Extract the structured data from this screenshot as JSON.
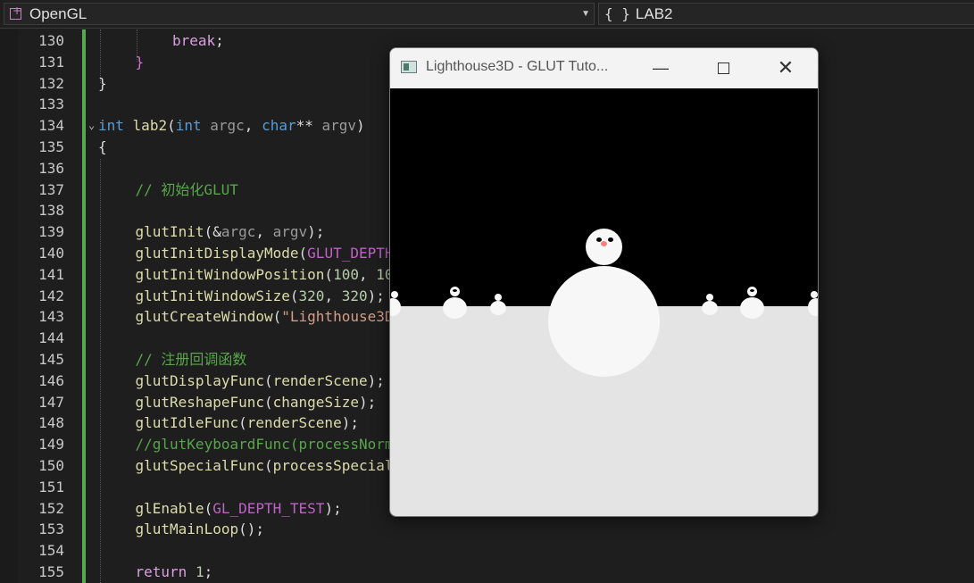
{
  "navbar": {
    "project": "OpenGL",
    "scope_icon": "{ }",
    "scope": "LAB2"
  },
  "editor": {
    "lines": [
      {
        "n": "130",
        "html": "<span class=\"ctl\">break</span>;"
      },
      {
        "n": "131",
        "html": "<span class=\"par\">}</span>"
      },
      {
        "n": "132",
        "html": "}"
      },
      {
        "n": "133",
        "html": ""
      },
      {
        "n": "134",
        "html": "<span class=\"kw\">int</span> <span class=\"fn\">lab2</span>(<span class=\"kw\">int</span> <span class=\"pm\">argc</span>, <span class=\"kw\">char</span>** <span class=\"pm\">argv</span>)"
      },
      {
        "n": "135",
        "html": "{"
      },
      {
        "n": "136",
        "html": ""
      },
      {
        "n": "137",
        "html": "<span class=\"cm\">// 初始化GLUT</span>"
      },
      {
        "n": "138",
        "html": ""
      },
      {
        "n": "139",
        "html": "<span class=\"fn\">glutInit</span>(&amp;<span class=\"pm\">argc</span>, <span class=\"pm\">argv</span>);"
      },
      {
        "n": "140",
        "html": "<span class=\"fn\">glutInitDisplayMode</span>(<span class=\"mac\">GLUT_DEPTH</span>"
      },
      {
        "n": "141",
        "html": "<span class=\"fn\">glutInitWindowPosition</span>(<span class=\"num\">100</span>, <span class=\"num\">100</span>"
      },
      {
        "n": "142",
        "html": "<span class=\"fn\">glutInitWindowSize</span>(<span class=\"num\">320</span>, <span class=\"num\">320</span>);"
      },
      {
        "n": "143",
        "html": "<span class=\"fn\">glutCreateWindow</span>(<span class=\"str\">\"Lighthouse3D</span>"
      },
      {
        "n": "144",
        "html": ""
      },
      {
        "n": "145",
        "html": "<span class=\"cm\">// 注册回调函数</span>"
      },
      {
        "n": "146",
        "html": "<span class=\"fn\">glutDisplayFunc</span>(<span class=\"fn\">renderScene</span>);"
      },
      {
        "n": "147",
        "html": "<span class=\"fn\">glutReshapeFunc</span>(<span class=\"fn\">changeSize</span>);"
      },
      {
        "n": "148",
        "html": "<span class=\"fn\">glutIdleFunc</span>(<span class=\"fn\">renderScene</span>);"
      },
      {
        "n": "149",
        "html": "<span class=\"cm\">//glutKeyboardFunc(processNormal</span>"
      },
      {
        "n": "150",
        "html": "<span class=\"fn\">glutSpecialFunc</span>(<span class=\"fn\">processSpecial</span>"
      },
      {
        "n": "151",
        "html": ""
      },
      {
        "n": "152",
        "html": "<span class=\"fn\">glEnable</span>(<span class=\"mac\">GL_DEPTH_TEST</span>);"
      },
      {
        "n": "153",
        "html": "<span class=\"fn\">glutMainLoop</span>();"
      },
      {
        "n": "154",
        "html": ""
      },
      {
        "n": "155",
        "html": "<span class=\"ctl\">return</span> <span class=\"num\">1</span>;"
      }
    ]
  },
  "glut_window": {
    "title": "Lighthouse3D - GLUT Tuto...",
    "minimize": "—",
    "close": "✕"
  }
}
